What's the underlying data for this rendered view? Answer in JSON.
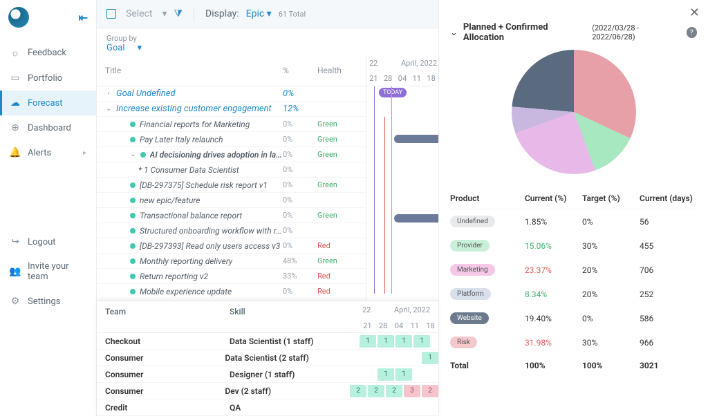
{
  "sidebar": {
    "items": [
      {
        "icon": "bulb",
        "label": "Feedback"
      },
      {
        "icon": "briefcase",
        "label": "Portfolio"
      },
      {
        "icon": "cloud",
        "label": "Forecast"
      },
      {
        "icon": "target",
        "label": "Dashboard"
      },
      {
        "icon": "bell",
        "label": "Alerts"
      }
    ],
    "bottom": [
      {
        "icon": "logout",
        "label": "Logout"
      },
      {
        "icon": "invite",
        "label": "Invite your team"
      },
      {
        "icon": "gear",
        "label": "Settings"
      }
    ]
  },
  "toolbar": {
    "select_label": "Select",
    "display_label": "Display:",
    "display_value": "Epic",
    "total": "61 Total"
  },
  "groupby": {
    "label": "Group by",
    "value": "Goal"
  },
  "grid": {
    "headers": {
      "title": "Title",
      "pct": "%",
      "health": "Health"
    },
    "groups": [
      {
        "type": "group",
        "chev": "›",
        "title": "Goal Undefined",
        "pct": "0%"
      },
      {
        "type": "group",
        "chev": "⌄",
        "title": "Increase existing customer engagement",
        "pct": "12%"
      }
    ],
    "rows": [
      {
        "title": "Financial reports for Marketing",
        "pct": "0%",
        "health": "Green",
        "hc": "green",
        "dot": true,
        "indent": 2
      },
      {
        "title": "Pay Later Italy relaunch",
        "pct": "0%",
        "health": "Green",
        "hc": "green",
        "dot": true,
        "indent": 2
      },
      {
        "title": "AI decisioning drives adoption in larger m…",
        "pct": "0%",
        "health": "Green",
        "hc": "green",
        "dot": true,
        "indent": 2,
        "chev": "⌄",
        "bold": true
      },
      {
        "title": "* 1 Consumer Data Scientist",
        "pct": "0%",
        "health": "",
        "hc": "",
        "dot": false,
        "indent": 3
      },
      {
        "title": "[DB-297375] Schedule risk report v1",
        "pct": "0%",
        "health": "Green",
        "hc": "green",
        "dot": true,
        "indent": 2
      },
      {
        "title": "new epic/feature",
        "pct": "0%",
        "health": "",
        "hc": "",
        "dot": true,
        "indent": 2
      },
      {
        "title": "Transactional balance report",
        "pct": "0%",
        "health": "Green",
        "hc": "green",
        "dot": true,
        "indent": 2
      },
      {
        "title": "Structured onboarding workflow with real ti…",
        "pct": "0%",
        "health": "",
        "hc": "",
        "dot": true,
        "indent": 2
      },
      {
        "title": "[DB-297393] Read only users access v3",
        "pct": "0%",
        "health": "Red",
        "hc": "red",
        "dot": true,
        "indent": 2
      },
      {
        "title": "Monthly reporting delivery",
        "pct": "48%",
        "health": "Green",
        "hc": "green",
        "dot": true,
        "indent": 2
      },
      {
        "title": "Return reporting v2",
        "pct": "33%",
        "health": "Red",
        "hc": "red",
        "dot": true,
        "indent": 2
      },
      {
        "title": "Mobile experience update",
        "pct": "0%",
        "health": "Red",
        "hc": "red",
        "dot": true,
        "indent": 2
      }
    ]
  },
  "timeline": {
    "month_a": "22",
    "month_b": "April, 2022",
    "days": [
      "21",
      "28",
      "04",
      "11",
      "18"
    ],
    "today": "TODAY"
  },
  "teams": {
    "headers": {
      "team": "Team",
      "skill": "Skill"
    },
    "rows": [
      {
        "team": "Checkout",
        "skill": "Data Scientist (1 staff)",
        "cells": [
          {
            "v": "1",
            "c": "g"
          },
          {
            "v": "1",
            "c": "g"
          },
          {
            "v": "1",
            "c": "g"
          },
          {
            "v": "1",
            "c": "g"
          }
        ]
      },
      {
        "team": "Consumer",
        "skill": "Data Scientist (2 staff)",
        "cells": [
          {
            "v": "",
            "c": ""
          },
          {
            "v": "",
            "c": ""
          },
          {
            "v": "",
            "c": ""
          },
          {
            "v": "",
            "c": ""
          },
          {
            "v": "1",
            "c": "g"
          }
        ]
      },
      {
        "team": "Consumer",
        "skill": "Designer (1 staff)",
        "cells": [
          {
            "v": "",
            "c": ""
          },
          {
            "v": "1",
            "c": "g"
          },
          {
            "v": "1",
            "c": "g"
          }
        ]
      },
      {
        "team": "Consumer",
        "skill": "Dev (2 staff)",
        "cells": [
          {
            "v": "2",
            "c": "g"
          },
          {
            "v": "2",
            "c": "g"
          },
          {
            "v": "2",
            "c": "g"
          },
          {
            "v": "3",
            "c": "r"
          },
          {
            "v": "2",
            "c": "r"
          }
        ]
      },
      {
        "team": "Credit",
        "skill": "QA",
        "cells": []
      }
    ]
  },
  "panel": {
    "title": "Planned + Confirmed Allocation",
    "range": "(2022/03/28 - 2022/06/28)",
    "headers": {
      "product": "Product",
      "current": "Current (%)",
      "target": "Target (%)",
      "days": "Current (days)"
    },
    "rows": [
      {
        "name": "Undefined",
        "pill": "undefined",
        "current": "1.85%",
        "cc": "",
        "target": "0%",
        "days": "56"
      },
      {
        "name": "Provider",
        "pill": "provider",
        "current": "15.06%",
        "cc": "green",
        "target": "30%",
        "days": "455"
      },
      {
        "name": "Marketing",
        "pill": "marketing",
        "current": "23.37%",
        "cc": "red",
        "target": "20%",
        "days": "706"
      },
      {
        "name": "Platform",
        "pill": "platform",
        "current": "8.34%",
        "cc": "green",
        "target": "20%",
        "days": "252"
      },
      {
        "name": "Website",
        "pill": "website",
        "current": "19.40%",
        "cc": "",
        "target": "0%",
        "days": "586"
      },
      {
        "name": "Risk",
        "pill": "risk",
        "current": "31.98%",
        "cc": "red",
        "target": "30%",
        "days": "966"
      }
    ],
    "total": {
      "label": "Total",
      "current": "100%",
      "target": "100%",
      "days": "3021"
    }
  },
  "chart_data": {
    "type": "pie",
    "title": "Planned + Confirmed Allocation (2022/03/28 - 2022/06/28)",
    "series": [
      {
        "name": "Undefined",
        "value": 1.85,
        "color": "#e8eaec"
      },
      {
        "name": "Provider",
        "value": 15.06,
        "color": "#a8e8c0"
      },
      {
        "name": "Marketing",
        "value": 23.37,
        "color": "#e8b8e8"
      },
      {
        "name": "Platform",
        "value": 8.34,
        "color": "#c8b8e0"
      },
      {
        "name": "Website",
        "value": 19.4,
        "color": "#5a6b80"
      },
      {
        "name": "Risk",
        "value": 31.98,
        "color": "#e8a0a8"
      }
    ]
  }
}
